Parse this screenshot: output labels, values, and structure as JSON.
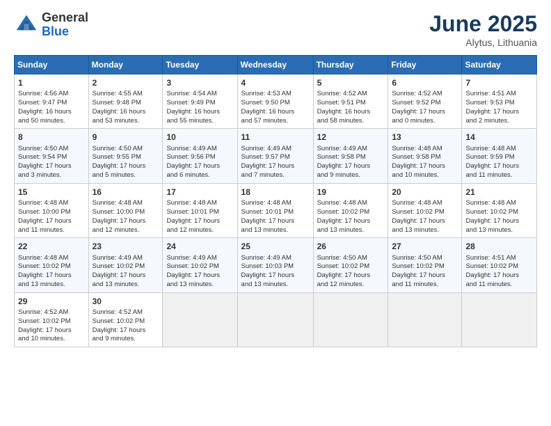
{
  "logo": {
    "general": "General",
    "blue": "Blue"
  },
  "title": "June 2025",
  "location": "Alytus, Lithuania",
  "days_header": [
    "Sunday",
    "Monday",
    "Tuesday",
    "Wednesday",
    "Thursday",
    "Friday",
    "Saturday"
  ],
  "weeks": [
    [
      {
        "day": "1",
        "info": "Sunrise: 4:56 AM\nSunset: 9:47 PM\nDaylight: 16 hours\nand 50 minutes."
      },
      {
        "day": "2",
        "info": "Sunrise: 4:55 AM\nSunset: 9:48 PM\nDaylight: 16 hours\nand 53 minutes."
      },
      {
        "day": "3",
        "info": "Sunrise: 4:54 AM\nSunset: 9:49 PM\nDaylight: 16 hours\nand 55 minutes."
      },
      {
        "day": "4",
        "info": "Sunrise: 4:53 AM\nSunset: 9:50 PM\nDaylight: 16 hours\nand 57 minutes."
      },
      {
        "day": "5",
        "info": "Sunrise: 4:52 AM\nSunset: 9:51 PM\nDaylight: 16 hours\nand 58 minutes."
      },
      {
        "day": "6",
        "info": "Sunrise: 4:52 AM\nSunset: 9:52 PM\nDaylight: 17 hours\nand 0 minutes."
      },
      {
        "day": "7",
        "info": "Sunrise: 4:51 AM\nSunset: 9:53 PM\nDaylight: 17 hours\nand 2 minutes."
      }
    ],
    [
      {
        "day": "8",
        "info": "Sunrise: 4:50 AM\nSunset: 9:54 PM\nDaylight: 17 hours\nand 3 minutes."
      },
      {
        "day": "9",
        "info": "Sunrise: 4:50 AM\nSunset: 9:55 PM\nDaylight: 17 hours\nand 5 minutes."
      },
      {
        "day": "10",
        "info": "Sunrise: 4:49 AM\nSunset: 9:56 PM\nDaylight: 17 hours\nand 6 minutes."
      },
      {
        "day": "11",
        "info": "Sunrise: 4:49 AM\nSunset: 9:57 PM\nDaylight: 17 hours\nand 7 minutes."
      },
      {
        "day": "12",
        "info": "Sunrise: 4:49 AM\nSunset: 9:58 PM\nDaylight: 17 hours\nand 9 minutes."
      },
      {
        "day": "13",
        "info": "Sunrise: 4:48 AM\nSunset: 9:58 PM\nDaylight: 17 hours\nand 10 minutes."
      },
      {
        "day": "14",
        "info": "Sunrise: 4:48 AM\nSunset: 9:59 PM\nDaylight: 17 hours\nand 11 minutes."
      }
    ],
    [
      {
        "day": "15",
        "info": "Sunrise: 4:48 AM\nSunset: 10:00 PM\nDaylight: 17 hours\nand 11 minutes."
      },
      {
        "day": "16",
        "info": "Sunrise: 4:48 AM\nSunset: 10:00 PM\nDaylight: 17 hours\nand 12 minutes."
      },
      {
        "day": "17",
        "info": "Sunrise: 4:48 AM\nSunset: 10:01 PM\nDaylight: 17 hours\nand 12 minutes."
      },
      {
        "day": "18",
        "info": "Sunrise: 4:48 AM\nSunset: 10:01 PM\nDaylight: 17 hours\nand 13 minutes."
      },
      {
        "day": "19",
        "info": "Sunrise: 4:48 AM\nSunset: 10:02 PM\nDaylight: 17 hours\nand 13 minutes."
      },
      {
        "day": "20",
        "info": "Sunrise: 4:48 AM\nSunset: 10:02 PM\nDaylight: 17 hours\nand 13 minutes."
      },
      {
        "day": "21",
        "info": "Sunrise: 4:48 AM\nSunset: 10:02 PM\nDaylight: 17 hours\nand 13 minutes."
      }
    ],
    [
      {
        "day": "22",
        "info": "Sunrise: 4:48 AM\nSunset: 10:02 PM\nDaylight: 17 hours\nand 13 minutes."
      },
      {
        "day": "23",
        "info": "Sunrise: 4:49 AM\nSunset: 10:02 PM\nDaylight: 17 hours\nand 13 minutes."
      },
      {
        "day": "24",
        "info": "Sunrise: 4:49 AM\nSunset: 10:02 PM\nDaylight: 17 hours\nand 13 minutes."
      },
      {
        "day": "25",
        "info": "Sunrise: 4:49 AM\nSunset: 10:03 PM\nDaylight: 17 hours\nand 13 minutes."
      },
      {
        "day": "26",
        "info": "Sunrise: 4:50 AM\nSunset: 10:02 PM\nDaylight: 17 hours\nand 12 minutes."
      },
      {
        "day": "27",
        "info": "Sunrise: 4:50 AM\nSunset: 10:02 PM\nDaylight: 17 hours\nand 11 minutes."
      },
      {
        "day": "28",
        "info": "Sunrise: 4:51 AM\nSunset: 10:02 PM\nDaylight: 17 hours\nand 11 minutes."
      }
    ],
    [
      {
        "day": "29",
        "info": "Sunrise: 4:52 AM\nSunset: 10:02 PM\nDaylight: 17 hours\nand 10 minutes."
      },
      {
        "day": "30",
        "info": "Sunrise: 4:52 AM\nSunset: 10:02 PM\nDaylight: 17 hours\nand 9 minutes."
      },
      null,
      null,
      null,
      null,
      null
    ]
  ]
}
